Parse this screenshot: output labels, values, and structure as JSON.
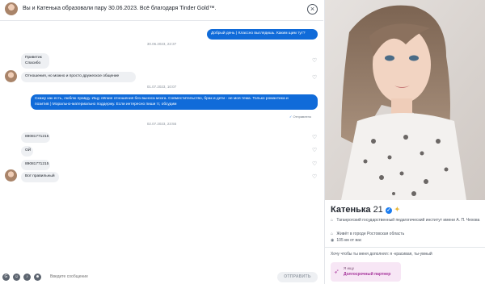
{
  "header": {
    "title": "Вы и Катенька образовали пару 30.06.2023. Всё благодаря Tinder Gold™.",
    "close_icon": "close-icon"
  },
  "messages": [
    {
      "type": "date",
      "text": "30.06.2023, 22:37"
    },
    {
      "type": "out",
      "text": "Добрый день ) Классно выглядишь. Каким щим тут?"
    },
    {
      "type": "in",
      "lines": [
        "Приветик",
        "Спасибо"
      ]
    },
    {
      "type": "in",
      "lines": [
        "Отношения, но можно и просто дружеское общение"
      ]
    },
    {
      "type": "date",
      "text": "01.07.2023, 10:07"
    },
    {
      "type": "out",
      "lines": [
        "Скажу как есть, люблю правду. Ищу лёгкие отношения без выноса мозга. Совместительство, брак и дети - не моя тема. Только романтика и",
        "позитив ) Морально-материально поддержу. Если интересно пиши тг, обсудим"
      ],
      "status": "Отправлено"
    },
    {
      "type": "date",
      "text": "02.07.2023, 23:55"
    },
    {
      "type": "in",
      "lines": [
        "89081771215"
      ]
    },
    {
      "type": "in",
      "lines": [
        "ОЙ"
      ]
    },
    {
      "type": "in",
      "lines": [
        "89081771215"
      ]
    },
    {
      "type": "in",
      "lines": [
        "Вот правильный"
      ]
    }
  ],
  "composer": {
    "placeholder": "Введите сообщение",
    "send_label": "ОТПРАВИТЬ"
  },
  "profile": {
    "name": "Катенька",
    "age": "21",
    "school": "Таганрогский государственный педагогический институт имени А. П. Чехова",
    "city": "Живёт в городе Ростовская область",
    "distance": "105 км от вас",
    "bio": "Хочу чтобы ты меня дополнял: я -красивая, ты-умный",
    "goal_label": "Я ищу",
    "goal_value": "Долгосрочный партнер"
  },
  "colors": {
    "accent": "#106bd9",
    "incoming_bubble": "#eef0f3",
    "goal_bg": "#f7e6f5",
    "goal_text": "#a5329a",
    "verified": "#1a7cf0"
  }
}
